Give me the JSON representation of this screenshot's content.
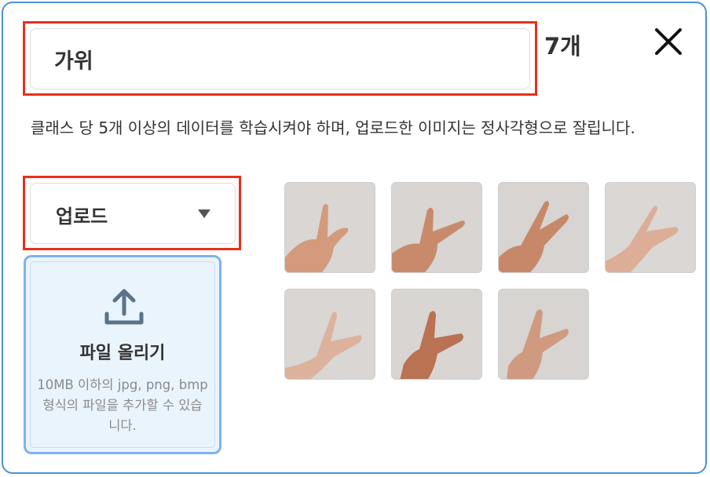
{
  "class_name": "가위",
  "sample_count": "7개",
  "description": "클래스 당 5개 이상의 데이터를 학습시켜야 하며, 업로드한 이미지는 정사각형으로 잘립니다.",
  "upload_dropdown": {
    "label": "업로드"
  },
  "dropzone": {
    "title": "파일 올리기",
    "hint": "10MB 이하의 jpg, png, bmp 형식의 파일을 추가할 수 있습니다."
  },
  "thumbnails": [
    {
      "alt": "scissors-hand-1"
    },
    {
      "alt": "scissors-hand-2"
    },
    {
      "alt": "scissors-hand-3"
    },
    {
      "alt": "scissors-hand-4"
    },
    {
      "alt": "scissors-hand-5"
    },
    {
      "alt": "scissors-hand-6"
    },
    {
      "alt": "scissors-hand-7"
    }
  ],
  "colors": {
    "accent": "#4a90e2",
    "highlight": "#e8301c",
    "dropzone_bg": "#eaf4fc"
  },
  "icons": {
    "close": "close-icon",
    "caret": "caret-down-icon",
    "upload": "upload-icon"
  }
}
